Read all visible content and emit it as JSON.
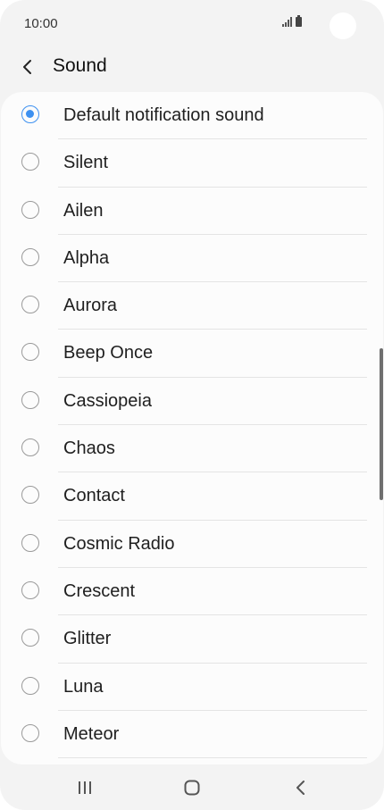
{
  "status_bar": {
    "time": "10:00"
  },
  "header": {
    "title": "Sound"
  },
  "sound_options": [
    {
      "label": "Default notification sound",
      "selected": true
    },
    {
      "label": "Silent",
      "selected": false
    },
    {
      "label": "Ailen",
      "selected": false
    },
    {
      "label": "Alpha",
      "selected": false
    },
    {
      "label": "Aurora",
      "selected": false
    },
    {
      "label": "Beep Once",
      "selected": false
    },
    {
      "label": "Cassiopeia",
      "selected": false
    },
    {
      "label": "Chaos",
      "selected": false
    },
    {
      "label": "Contact",
      "selected": false
    },
    {
      "label": "Cosmic Radio",
      "selected": false
    },
    {
      "label": "Crescent",
      "selected": false
    },
    {
      "label": "Glitter",
      "selected": false
    },
    {
      "label": "Luna",
      "selected": false
    },
    {
      "label": "Meteor",
      "selected": false
    }
  ],
  "colors": {
    "accent": "#3e91f0",
    "background": "#f3f3f3",
    "card": "#fcfcfc"
  },
  "icons": {
    "back": "chevron-left-icon",
    "recents": "recents-icon",
    "home": "home-icon",
    "nav_back": "back-icon"
  }
}
